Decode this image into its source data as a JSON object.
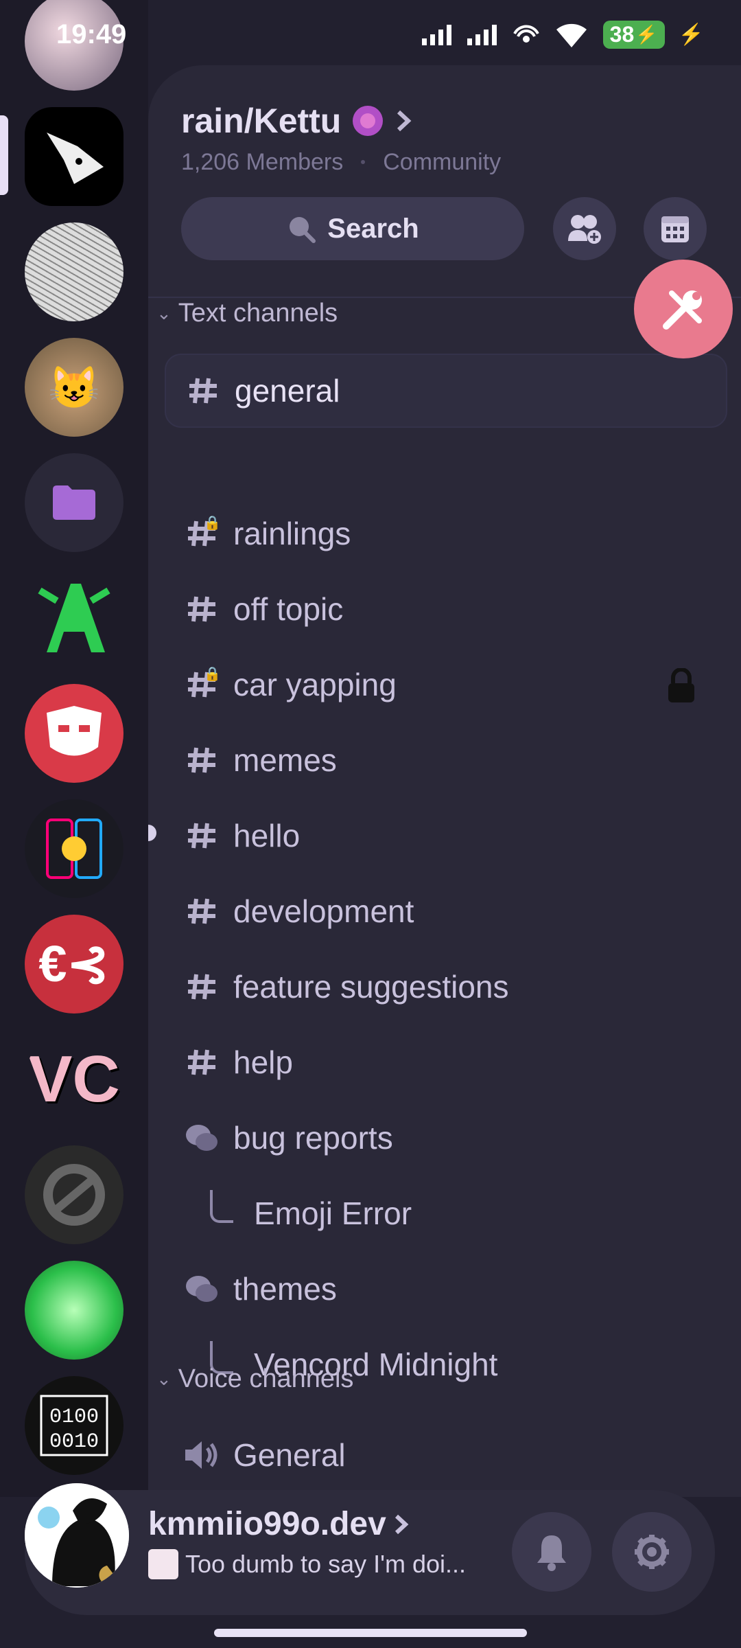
{
  "status_bar": {
    "time": "19:49",
    "battery": "38"
  },
  "servers": [
    {
      "name": "server-user-avatar"
    },
    {
      "name": "server-kettu"
    },
    {
      "name": "server-manga"
    },
    {
      "name": "server-cat"
    },
    {
      "name": "server-folder"
    },
    {
      "name": "server-green-logo"
    },
    {
      "name": "server-red-face"
    },
    {
      "name": "server-phones"
    },
    {
      "name": "server-red-logo"
    },
    {
      "name": "server-vc"
    },
    {
      "name": "server-gray-logo"
    },
    {
      "name": "server-green-anime"
    },
    {
      "name": "server-binary"
    }
  ],
  "server_header": {
    "name": "rain/Kettu",
    "members": "1,206 Members",
    "type": "Community",
    "search_label": "Search"
  },
  "text_category": "Text channels",
  "channels": [
    {
      "label": "general",
      "icon": "hash-icon",
      "active": true
    },
    {
      "label": "rainlings",
      "icon": "hash-lock-icon"
    },
    {
      "label": "off topic",
      "icon": "hash-icon"
    },
    {
      "label": "car yapping",
      "icon": "hash-lock-icon",
      "locked": true
    },
    {
      "label": "memes",
      "icon": "hash-icon"
    },
    {
      "label": "hello",
      "icon": "hash-icon",
      "unread": true
    },
    {
      "label": "development",
      "icon": "hash-icon"
    },
    {
      "label": "feature suggestions",
      "icon": "hash-icon"
    },
    {
      "label": "help",
      "icon": "hash-icon"
    },
    {
      "label": "bug reports",
      "icon": "forum-icon"
    },
    {
      "label": "Emoji Error",
      "thread": true
    },
    {
      "label": "themes",
      "icon": "forum-icon"
    },
    {
      "label": "Vencord Midnight",
      "thread": true
    }
  ],
  "voice_category": "Voice channels",
  "voice_channels": [
    {
      "label": "General",
      "icon": "speaker-icon"
    }
  ],
  "user": {
    "name": "kmmiio99o.dev",
    "status": "Too dumb to say I'm doi..."
  },
  "colors": {
    "accent": "#e97a8e",
    "background": "#22202f",
    "panel": "#2a2838"
  }
}
